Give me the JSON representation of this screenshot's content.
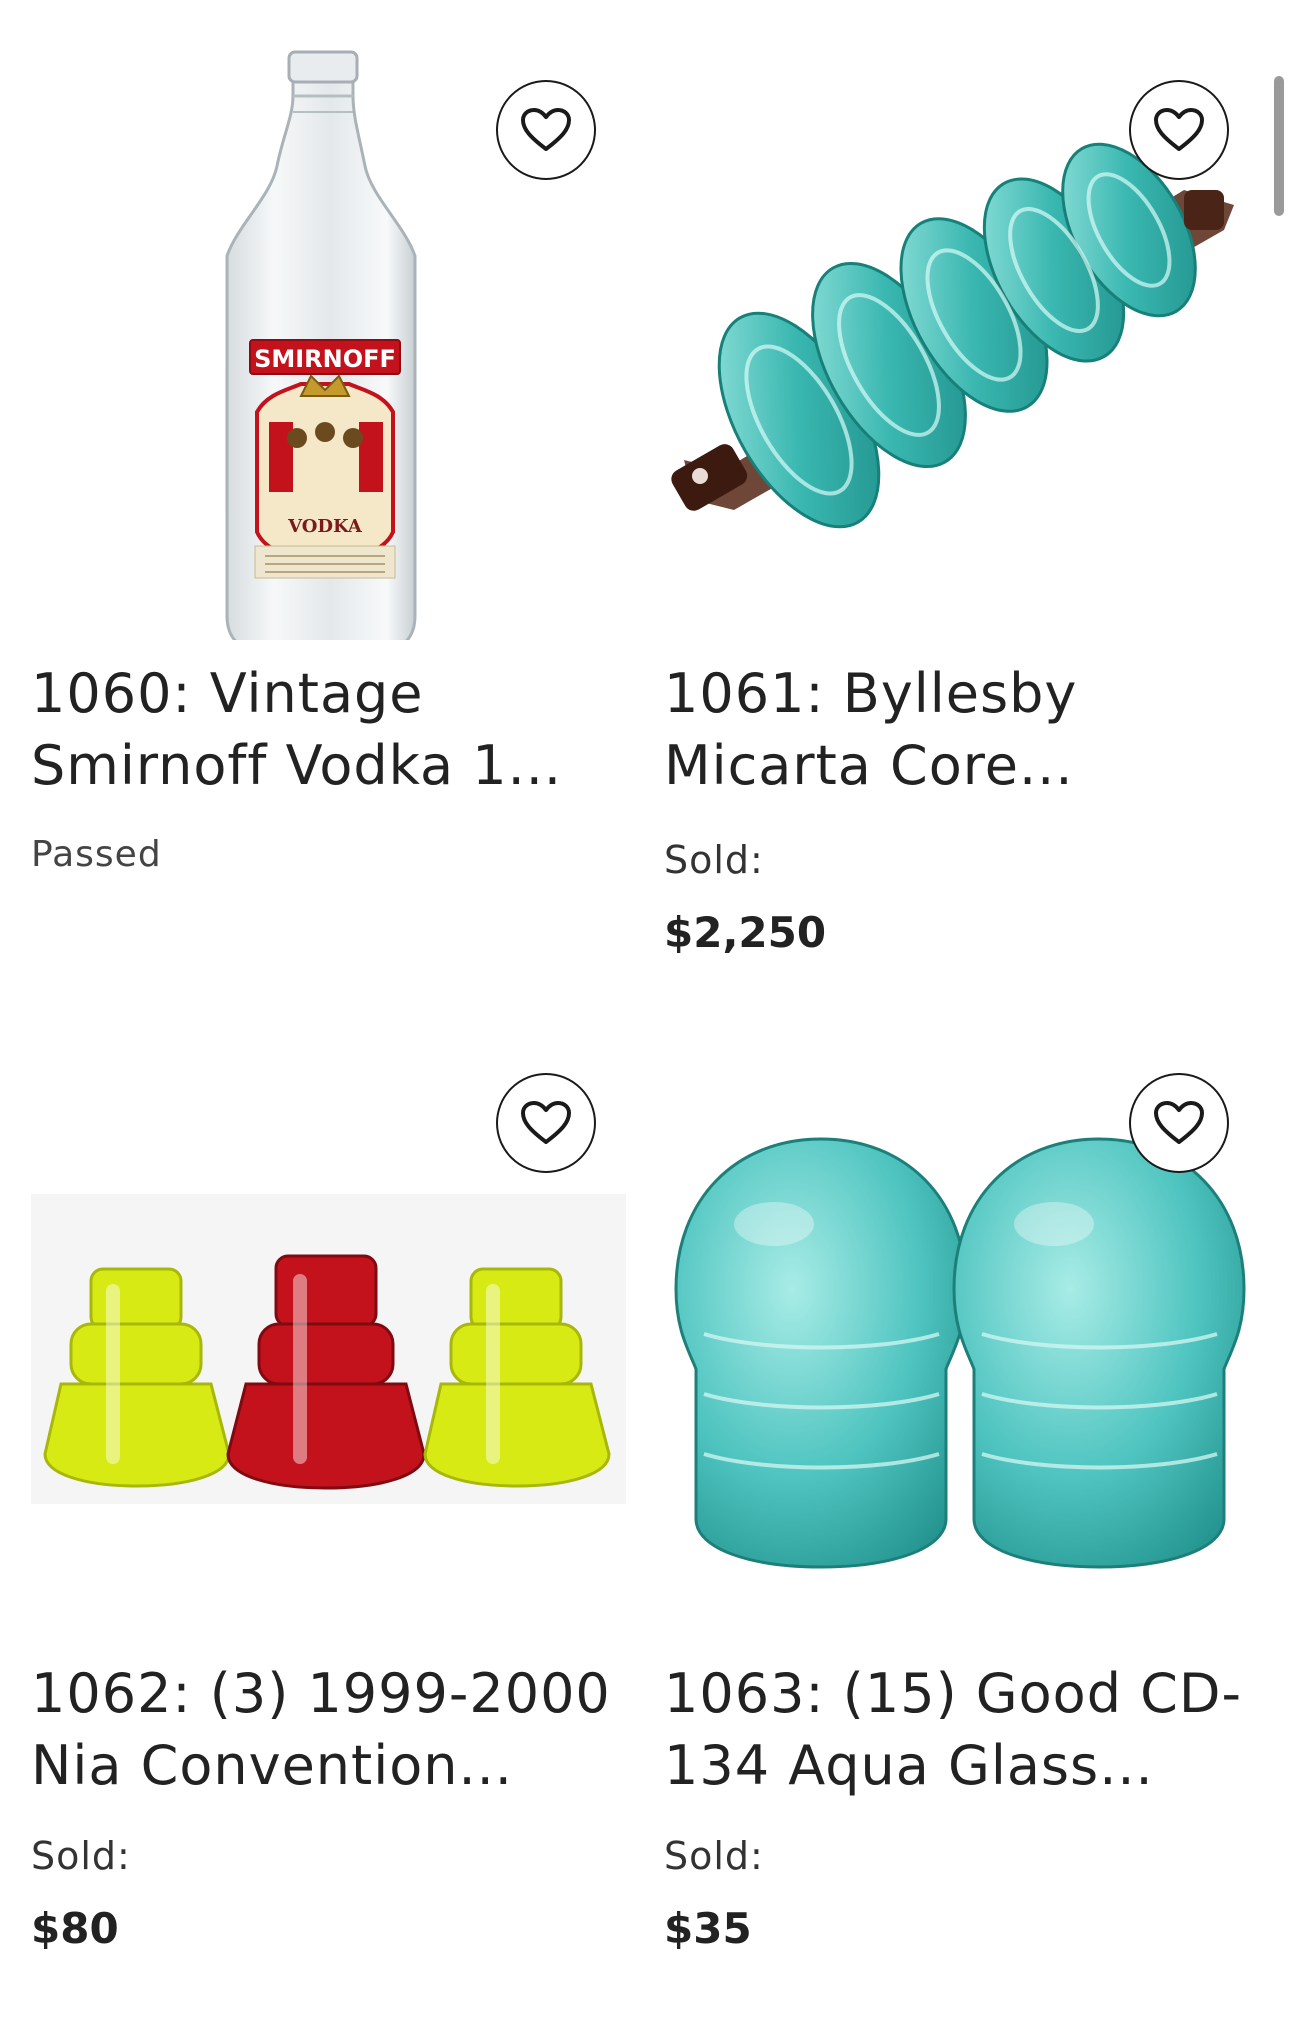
{
  "lots": [
    {
      "title": "1060: Vintage Smirnoff Vodka 1...",
      "status": "Passed",
      "price": "",
      "image": "vodka-bottle",
      "bottle_label": "SMIRNOFF",
      "bottle_sublabel": "VODKA"
    },
    {
      "title": "1061: Byllesby Micarta Core...",
      "status": "Sold:",
      "price": "$2,250",
      "image": "aqua-glass-insulator-string"
    },
    {
      "title": "1062: (3) 1999-2000 Nia Convention...",
      "status": "Sold:",
      "price": "$80",
      "image": "colored-glass-insulators"
    },
    {
      "title": "1063: (15) Good CD-134 Aqua Glass...",
      "status": "Sold:",
      "price": "$35",
      "image": "aqua-glass-insulators"
    }
  ],
  "colors": {
    "aqua": "#4fc4c0",
    "yellow": "#d8ea14",
    "red": "#c4121c",
    "rust": "#5a2e1e",
    "text": "#222222"
  },
  "icons": {
    "favorite": "heart-outline-icon"
  }
}
